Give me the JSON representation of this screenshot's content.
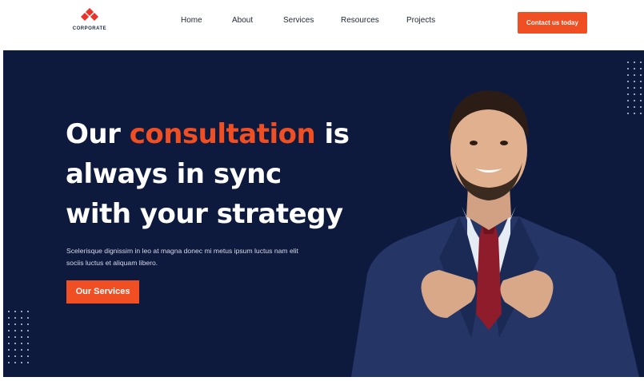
{
  "brand": {
    "name": "CORPORATE",
    "color": "#e8342a"
  },
  "nav": {
    "items": [
      {
        "label": "Home"
      },
      {
        "label": "About"
      },
      {
        "label": "Services"
      },
      {
        "label": "Resources"
      },
      {
        "label": "Projects"
      }
    ],
    "cta_label": "Contact us today"
  },
  "hero": {
    "headline": {
      "part1": "Our ",
      "accent": "consultation",
      "part2": " is",
      "line2": "always in sync",
      "line3": "with your strategy"
    },
    "subtext": "Scelerisque dignissim in leo at magna donec mi metus ipsum luctus nam elit sociis luctus et aliquam libero.",
    "button_label": "Our Services"
  },
  "colors": {
    "accent": "#f04f23",
    "hero_bg": "#0d1a3e",
    "text_light": "#ffffff"
  }
}
